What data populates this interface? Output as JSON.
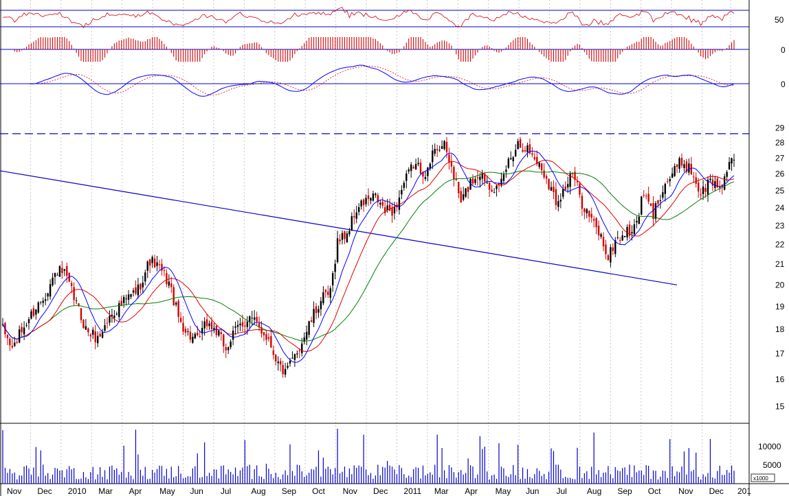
{
  "chart_data": {
    "type": "candlestick",
    "title": "",
    "colors": {
      "up_candle": "#000000",
      "down_candle": "#d40000",
      "ma_short": "#0000ff",
      "ma_mid": "#e00000",
      "ma_long": "#008000",
      "trendline": "#0000cc",
      "volume": "#0000cc",
      "rsi": "#d40000",
      "histogram": "#d40000"
    },
    "x_axis": {
      "labels": [
        "Nov",
        "Dec",
        "2010",
        "Mar",
        "Apr",
        "May",
        "Jun",
        "Jul",
        "Aug",
        "Sep",
        "Oct",
        "Nov",
        "Dec",
        "2011",
        "Mar",
        "Apr",
        "May",
        "Jun",
        "Jul",
        "Aug",
        "Sep",
        "Oct",
        "Nov",
        "Dec",
        "201"
      ],
      "grid": "dotted-vertical"
    },
    "price_panel": {
      "scale": "log",
      "ylim": [
        14.7,
        29.3
      ],
      "ticks": [
        "15",
        "16",
        "17",
        "18",
        "19",
        "20",
        "21",
        "22",
        "23",
        "24",
        "25",
        "26",
        "27",
        "28",
        "29"
      ],
      "resistance_level": 28.6,
      "trendline": {
        "start_value": 26.2,
        "end_value": 20.0
      },
      "moving_averages": [
        "short (blue)",
        "medium (red)",
        "long (green)"
      ],
      "price_path": [
        {
          "t": 0,
          "v": 18.0
        },
        {
          "t": 4,
          "v": 17.2
        },
        {
          "t": 10,
          "v": 18.3
        },
        {
          "t": 18,
          "v": 19.6
        },
        {
          "t": 23,
          "v": 20.7
        },
        {
          "t": 26,
          "v": 20.5
        },
        {
          "t": 30,
          "v": 19.4
        },
        {
          "t": 35,
          "v": 18.0
        },
        {
          "t": 40,
          "v": 17.6
        },
        {
          "t": 46,
          "v": 18.7
        },
        {
          "t": 52,
          "v": 19.3
        },
        {
          "t": 57,
          "v": 19.8
        },
        {
          "t": 62,
          "v": 21.2
        },
        {
          "t": 66,
          "v": 20.8
        },
        {
          "t": 70,
          "v": 20.1
        },
        {
          "t": 74,
          "v": 18.5
        },
        {
          "t": 78,
          "v": 17.8
        },
        {
          "t": 82,
          "v": 17.5
        },
        {
          "t": 86,
          "v": 18.3
        },
        {
          "t": 90,
          "v": 17.9
        },
        {
          "t": 94,
          "v": 17.2
        },
        {
          "t": 99,
          "v": 18.1
        },
        {
          "t": 104,
          "v": 18.5
        },
        {
          "t": 108,
          "v": 18.1
        },
        {
          "t": 112,
          "v": 17.6
        },
        {
          "t": 116,
          "v": 16.6
        },
        {
          "t": 119,
          "v": 16.2
        },
        {
          "t": 122,
          "v": 16.7
        },
        {
          "t": 126,
          "v": 17.5
        },
        {
          "t": 130,
          "v": 18.4
        },
        {
          "t": 134,
          "v": 19.3
        },
        {
          "t": 138,
          "v": 19.6
        },
        {
          "t": 141,
          "v": 22.2
        },
        {
          "t": 145,
          "v": 22.6
        },
        {
          "t": 149,
          "v": 23.9
        },
        {
          "t": 153,
          "v": 24.4
        },
        {
          "t": 157,
          "v": 24.6
        },
        {
          "t": 161,
          "v": 23.8
        },
        {
          "t": 165,
          "v": 23.9
        },
        {
          "t": 169,
          "v": 25.4
        },
        {
          "t": 173,
          "v": 26.6
        },
        {
          "t": 176,
          "v": 26.3
        },
        {
          "t": 179,
          "v": 26.1
        },
        {
          "t": 182,
          "v": 27.8
        },
        {
          "t": 186,
          "v": 27.7
        },
        {
          "t": 189,
          "v": 26.4
        },
        {
          "t": 193,
          "v": 24.3
        },
        {
          "t": 197,
          "v": 25.5
        },
        {
          "t": 201,
          "v": 26.1
        },
        {
          "t": 205,
          "v": 25.4
        },
        {
          "t": 209,
          "v": 25.0
        },
        {
          "t": 213,
          "v": 26.8
        },
        {
          "t": 217,
          "v": 28.0
        },
        {
          "t": 221,
          "v": 27.6
        },
        {
          "t": 225,
          "v": 26.8
        },
        {
          "t": 229,
          "v": 25.8
        },
        {
          "t": 233,
          "v": 24.4
        },
        {
          "t": 237,
          "v": 25.2
        },
        {
          "t": 240,
          "v": 26.0
        },
        {
          "t": 244,
          "v": 24.3
        },
        {
          "t": 248,
          "v": 23.3
        },
        {
          "t": 252,
          "v": 22.4
        },
        {
          "t": 255,
          "v": 21.3
        },
        {
          "t": 258,
          "v": 22.2
        },
        {
          "t": 262,
          "v": 22.6
        },
        {
          "t": 266,
          "v": 22.8
        },
        {
          "t": 270,
          "v": 24.8
        },
        {
          "t": 274,
          "v": 23.6
        },
        {
          "t": 278,
          "v": 25.2
        },
        {
          "t": 282,
          "v": 26.0
        },
        {
          "t": 286,
          "v": 26.8
        },
        {
          "t": 290,
          "v": 26.2
        },
        {
          "t": 294,
          "v": 24.8
        },
        {
          "t": 298,
          "v": 25.6
        },
        {
          "t": 302,
          "v": 25.2
        },
        {
          "t": 306,
          "v": 26.5
        },
        {
          "t": 308,
          "v": 26.7
        }
      ]
    },
    "indicator_panels": [
      {
        "name": "oscillator",
        "ticks": [
          "50"
        ],
        "style": "line"
      },
      {
        "name": "histogram",
        "ticks": [
          "0"
        ],
        "style": "bars"
      },
      {
        "name": "macd",
        "ticks": [
          "0"
        ],
        "style": "dual-line"
      }
    ],
    "volume_panel": {
      "ticks": [
        "10000",
        "5000"
      ],
      "multiplier_label": "x1000"
    }
  }
}
